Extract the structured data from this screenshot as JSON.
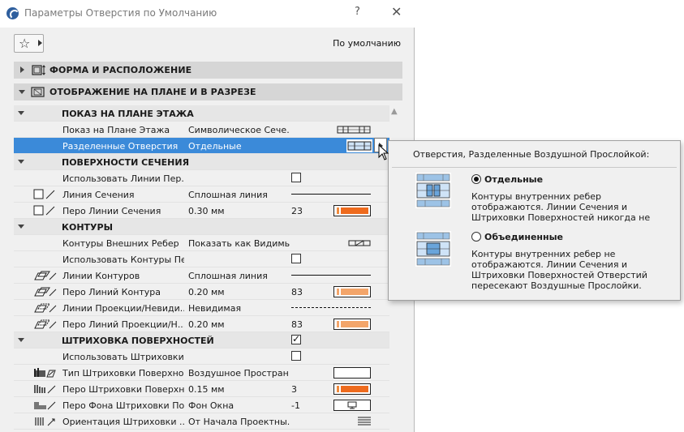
{
  "window": {
    "title": "Параметры Отверстия по Умолчанию",
    "help": "?",
    "close": "✕"
  },
  "toolbar": {
    "favorites_icon": "star-icon",
    "default_label": "По умолчанию"
  },
  "sections": [
    {
      "label": "ФОРМА И РАСПОЛОЖЕНИЕ",
      "expanded": false
    },
    {
      "label": "ОТОБРАЖЕНИЕ НА ПЛАНЕ И В РАЗРЕЗЕ",
      "expanded": true
    }
  ],
  "groups": {
    "floor_plan": "ПОКАЗ НА ПЛАНЕ ЭТАЖА",
    "cut_surfaces": "ПОВЕРХНОСТИ СЕЧЕНИЯ",
    "outlines": "КОНТУРЫ",
    "cover_fills": "ШТРИХОВКА ПОВЕРХНОСТЕЙ"
  },
  "rows": {
    "show_on_floor": {
      "name": "Показ на Плане Этажа",
      "value": "Символическое Сече..."
    },
    "separated": {
      "name": "Разделенные Отверстия",
      "value": "Отдельные"
    },
    "use_cut_lines": {
      "name": "Использовать Линии Пер...",
      "checked": false
    },
    "cut_line": {
      "name": "Линия Сечения",
      "value": "Сплошная линия"
    },
    "cut_line_pen": {
      "name": "Перо Линии Сечения",
      "value": "0.30 мм",
      "pen": "23"
    },
    "outer_outlines": {
      "name": "Контуры Внешних Ребер",
      "value": "Показать как Видимы..."
    },
    "use_outline_pens": {
      "name": "Использовать Контуры Пе...",
      "checked": false
    },
    "outline_lines": {
      "name": "Линии Контуров",
      "value": "Сплошная линия"
    },
    "outline_pen": {
      "name": "Перо Линий Контура",
      "value": "0.20 мм",
      "pen": "83"
    },
    "proj_lines": {
      "name": "Линии Проекции/Невиди...",
      "value": "Невидимая"
    },
    "proj_pen": {
      "name": "Перо Линий Проекции/Н...",
      "value": "0.20 мм",
      "pen": "83"
    },
    "cover_fills_group_checked": true,
    "use_fills": {
      "name": "Использовать Штриховки ...",
      "checked": false
    },
    "fill_type": {
      "name": "Тип Штриховки Поверхно...",
      "value": "Воздушное Простран..."
    },
    "fill_pen": {
      "name": "Перо Штриховки Поверхн...",
      "value": "0.15 мм",
      "pen": "3"
    },
    "fill_bg_pen": {
      "name": "Перо Фона Штриховки По...",
      "value": "Фон Окна",
      "pen": "-1"
    },
    "fill_orientation": {
      "name": "Ориентация Штриховки ...",
      "value": "От Начала Проектны..."
    }
  },
  "flyout": {
    "title": "Отверстия, Разделенные Воздушной Прослойкой:",
    "options": [
      {
        "label": "Отдельные",
        "selected": true,
        "desc": "Контуры внутренних ребер отображаются. Линии Сечения и Штриховки Поверхностей никогда не пересекают Воздушные"
      },
      {
        "label": "Объединенные",
        "selected": false,
        "desc": "Контуры внутренних ребер не отображаются. Линии Сечения и Штриховки Поверхностей Отверстий пересекают Воздушные Прослойки."
      }
    ]
  },
  "colors": {
    "selection": "#3b8ad9",
    "pen_orange": "#ee6b1e",
    "pen_light_orange": "#f3a56a"
  }
}
